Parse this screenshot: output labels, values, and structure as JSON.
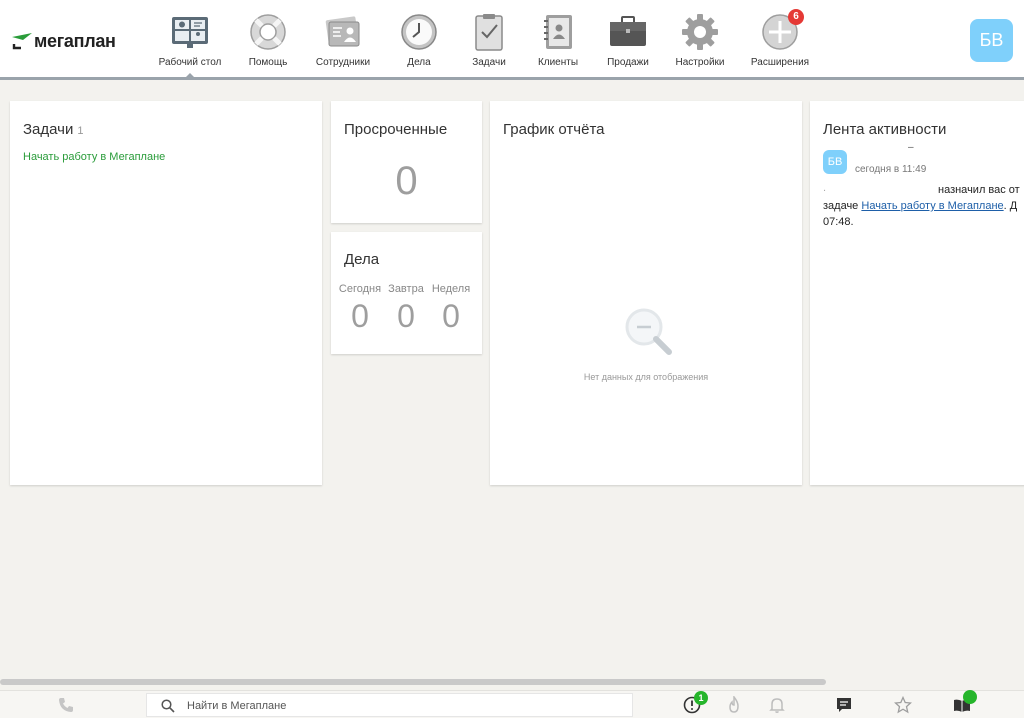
{
  "header": {
    "logo_text": "мегаплан",
    "nav": [
      {
        "label": "Рабочий стол",
        "icon": "desktop-icon",
        "active": true
      },
      {
        "label": "Помощь",
        "icon": "lifebuoy-icon"
      },
      {
        "label": "Сотрудники",
        "icon": "employees-icon"
      },
      {
        "label": "Дела",
        "icon": "clock-icon"
      },
      {
        "label": "Задачи",
        "icon": "tasks-clipboard-icon"
      },
      {
        "label": "Клиенты",
        "icon": "contacts-book-icon"
      },
      {
        "label": "Продажи",
        "icon": "briefcase-icon"
      },
      {
        "label": "Настройки",
        "icon": "gear-icon"
      },
      {
        "label": "Расширения",
        "icon": "plus-circle-icon",
        "badge": "6"
      }
    ],
    "avatar_initials": "БВ"
  },
  "tasks_card": {
    "title": "Задачи",
    "count": "1",
    "items": [
      "Начать работу в Мегаплане"
    ]
  },
  "overdue_card": {
    "title": "Просроченные",
    "value": "0"
  },
  "deals_card": {
    "title": "Дела",
    "columns": [
      {
        "label": "Сегодня",
        "value": "0"
      },
      {
        "label": "Завтра",
        "value": "0"
      },
      {
        "label": "Неделя",
        "value": "0"
      }
    ]
  },
  "chart_card": {
    "title": "График отчёта",
    "empty_text": "Нет данных для отображения"
  },
  "feed_card": {
    "title": "Лента активности",
    "avatar_initials": "БВ",
    "dash": "–",
    "time": "сегодня в 11:49",
    "dot": ".",
    "line1": "назначил вас от",
    "line2_prefix": "задаче ",
    "line2_link": "Начать работу в Мегаплане",
    "line2_suffix": ". Д",
    "line3": "07:48."
  },
  "bottombar": {
    "search_placeholder": "Найти в Мегаплане",
    "alerts_badge": "1"
  },
  "colors": {
    "accent_green": "#2a9c3a",
    "avatar_blue": "#7fd0fb",
    "badge_red": "#e53935",
    "link_blue": "#1e5fa8"
  }
}
